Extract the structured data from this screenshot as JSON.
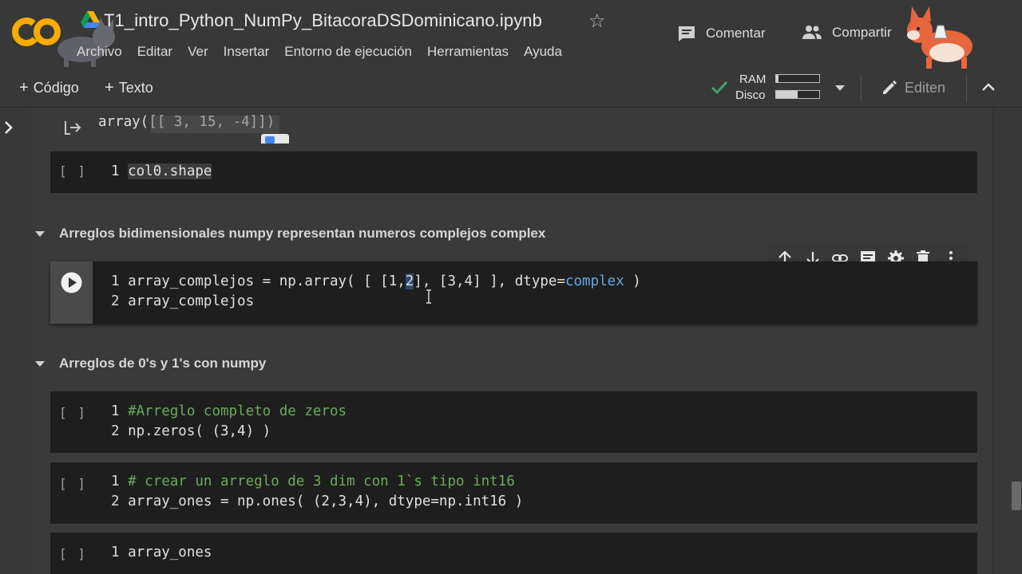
{
  "header": {
    "title": "T1_intro_Python_NumPy_BitacoraDSDominicano.ipynb",
    "menu": [
      "Archivo",
      "Editar",
      "Ver",
      "Insertar",
      "Entorno de ejecución",
      "Herramientas",
      "Ayuda"
    ],
    "comment_label": "Comentar",
    "share_label": "Compartir"
  },
  "toolbar": {
    "code_label": "Código",
    "text_label": "Texto",
    "ram_label": "RAM",
    "disk_label": "Disco",
    "ram_fraction": 0.05,
    "disk_fraction": 0.5,
    "edit_label": "Editen"
  },
  "output": {
    "text": "array([[ 3, 15, -4]])"
  },
  "cells": {
    "shape": {
      "bracket": "[ ]",
      "line1_no": "1",
      "line1": "col0.shape"
    },
    "complex": {
      "line1_no": "1",
      "line2_no": "2",
      "line2": "array_complejos"
    },
    "zeros": {
      "bracket": "[ ]",
      "line1_no": "1",
      "line1": "#Arreglo completo de zeros",
      "line2_no": "2",
      "line2": "np.zeros( (3,4) )"
    },
    "ones": {
      "bracket": "[ ]",
      "line1_no": "1",
      "line1": "# crear un arreglo de 3 dim con 1`s tipo int16",
      "line2_no": "2",
      "line2": "array_ones = np.ones( (2,3,4), dtype=np.int16 )"
    },
    "ones_show": {
      "bracket": "[ ]",
      "line1_no": "1",
      "line1": "array_ones"
    }
  },
  "complex_code": {
    "a": "array_complejos = np.array( [ [1,",
    "b": "2",
    "c": "], [3,4] ], dtype=",
    "d": "complex",
    "e": " )"
  },
  "sections": {
    "bidim": "Arreglos bidimensionales numpy representan numeros complejos complex",
    "zeros_ones": "Arreglos de 0's y 1's con numpy"
  },
  "colors": {
    "background": "#383838",
    "cell": "#1e1e1e",
    "comment": "#6aab5a",
    "keyword": "#5fa9e8",
    "check": "#3fa36b",
    "logo": "#f9ab00"
  }
}
